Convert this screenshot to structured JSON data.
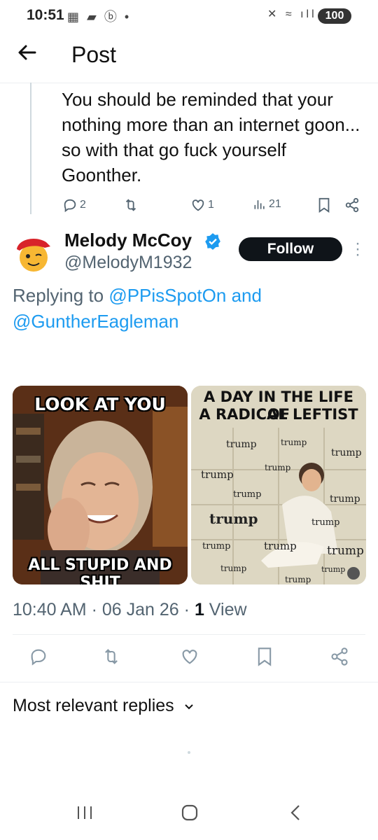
{
  "status_bar": {
    "time": "10:51",
    "battery": "100",
    "left_icons": "▦ ▰ ⓑ •",
    "right_icons": "✕ ≈ ıll"
  },
  "header": {
    "title": "Post",
    "back_icon": "arrow-left-icon"
  },
  "parent_post": {
    "text": "You should be reminded that your nothing more than an internet goon... so with that go fuck yourself Goonther.",
    "replies": "2",
    "reposts": "",
    "likes": "1",
    "views": "21"
  },
  "post": {
    "name": "Melody McCoy",
    "handle": "@MelodyM1932",
    "follow_label": "Follow",
    "replying_prefix": "Replying to ",
    "replying_user1": "@PPisSpotOn",
    "replying_and": " and",
    "replying_user2": "@GuntherEagleman",
    "image1": {
      "top_text": "LOOK AT YOU",
      "bottom_text": "ALL STUPID AND SHIT"
    },
    "image2": {
      "top_text_line1": "A DAY IN THE LIFE OF",
      "top_text_line2": "A RADICAL LEFTIST",
      "wall_word": "trump"
    },
    "time": "10:40 AM",
    "date": "06 Jan 26",
    "views_count": "1",
    "views_label": "View"
  },
  "replies_section": {
    "label": "Most relevant replies"
  },
  "colors": {
    "accent": "#1d9bf0",
    "text": "#0f1419",
    "muted": "#536471"
  }
}
